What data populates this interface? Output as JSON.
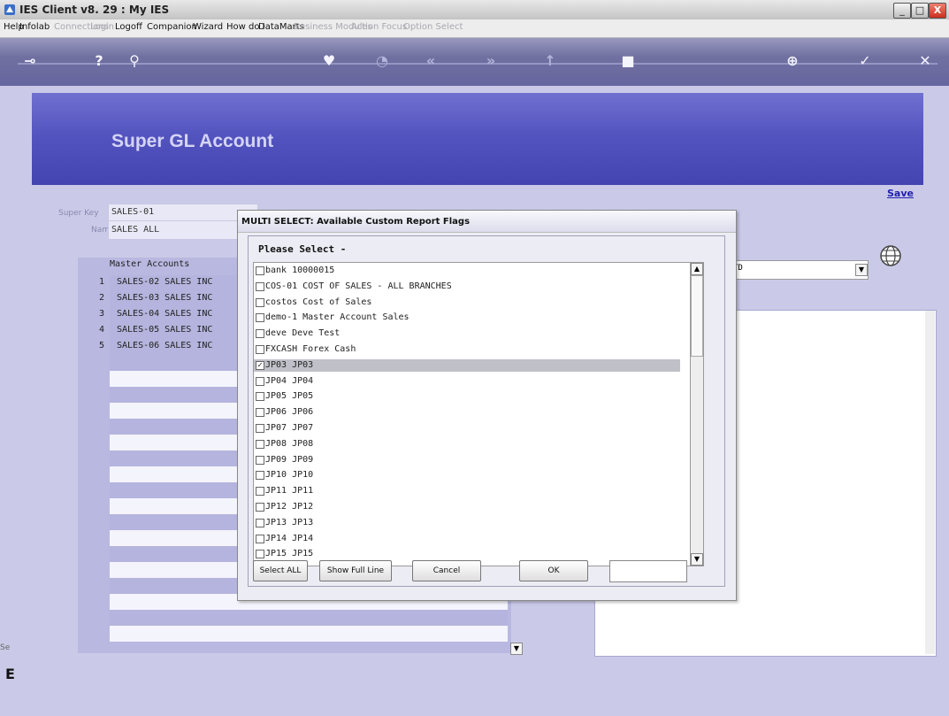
{
  "window": {
    "title": "IES Client v8. 29 : My IES",
    "buttons": [
      "_",
      "□",
      "X"
    ]
  },
  "menu": [
    {
      "label": "Help",
      "enabled": true
    },
    {
      "label": "Infolab",
      "enabled": true
    },
    {
      "label": "Connections",
      "enabled": false
    },
    {
      "label": "Login",
      "enabled": false
    },
    {
      "label": "Logoff",
      "enabled": true
    },
    {
      "label": "Companion",
      "enabled": true
    },
    {
      "label": "Wizard",
      "enabled": true
    },
    {
      "label": "How do I",
      "enabled": true
    },
    {
      "label": "DataMarts",
      "enabled": true
    },
    {
      "label": "Business Modules",
      "enabled": false
    },
    {
      "label": "Action Focus",
      "enabled": false
    },
    {
      "label": "Option Select",
      "enabled": false
    }
  ],
  "toolbar": {
    "icons": [
      "key-icon",
      "help-icon",
      "search-icon",
      "heart-icon",
      "clock-icon",
      "rewind-icon",
      "forward-icon",
      "bookmark-icon",
      "stop-icon",
      "add-icon",
      "check-icon",
      "close-icon"
    ],
    "glyphs": [
      "⊸",
      "?",
      "⚲",
      "♥",
      "◔",
      "«",
      "»",
      "↑",
      "■",
      "⊕",
      "✓",
      "✕"
    ]
  },
  "page": {
    "title": "Super GL Account",
    "save_label": "Save",
    "super_key_label": "Super Key",
    "super_key_value": "SALES-01",
    "name_label": "Name",
    "name_value": "SALES ALL",
    "right_dropdown_value": "TD"
  },
  "master": {
    "header": "Master Accounts",
    "rows": [
      {
        "num": "1",
        "text": "SALES-02 SALES INC"
      },
      {
        "num": "2",
        "text": "SALES-03 SALES INC"
      },
      {
        "num": "3",
        "text": "SALES-04 SALES INC"
      },
      {
        "num": "4",
        "text": "SALES-05 SALES INC"
      },
      {
        "num": "5",
        "text": "SALES-06 SALES INC"
      }
    ]
  },
  "modal": {
    "title": "MULTI SELECT: Available Custom Report Flags",
    "prompt": "Please Select -",
    "items": [
      {
        "text": "bank 10000015",
        "checked": false
      },
      {
        "text": "COS-01 COST OF SALES - ALL BRANCHES",
        "checked": false
      },
      {
        "text": "costos Cost of Sales",
        "checked": false
      },
      {
        "text": "demo-1 Master Account Sales",
        "checked": false
      },
      {
        "text": "deve Deve Test",
        "checked": false
      },
      {
        "text": "FXCASH Forex Cash",
        "checked": false
      },
      {
        "text": "JP03 JP03",
        "checked": true
      },
      {
        "text": "JP04 JP04",
        "checked": false
      },
      {
        "text": "JP05 JP05",
        "checked": false
      },
      {
        "text": "JP06 JP06",
        "checked": false
      },
      {
        "text": "JP07 JP07",
        "checked": false
      },
      {
        "text": "JP08 JP08",
        "checked": false
      },
      {
        "text": "JP09 JP09",
        "checked": false
      },
      {
        "text": "JP10 JP10",
        "checked": false
      },
      {
        "text": "JP11 JP11",
        "checked": false
      },
      {
        "text": "JP12 JP12",
        "checked": false
      },
      {
        "text": "JP13 JP13",
        "checked": false
      },
      {
        "text": "JP14 JP14",
        "checked": false
      },
      {
        "text": "JP15 JP15",
        "checked": false
      }
    ],
    "buttons": {
      "select_all": "Select ALL",
      "show_full_line": "Show Full Line",
      "cancel": "Cancel",
      "ok": "OK"
    },
    "input_value": ""
  },
  "corner": {
    "se_text": "Se",
    "e_text": "E"
  }
}
